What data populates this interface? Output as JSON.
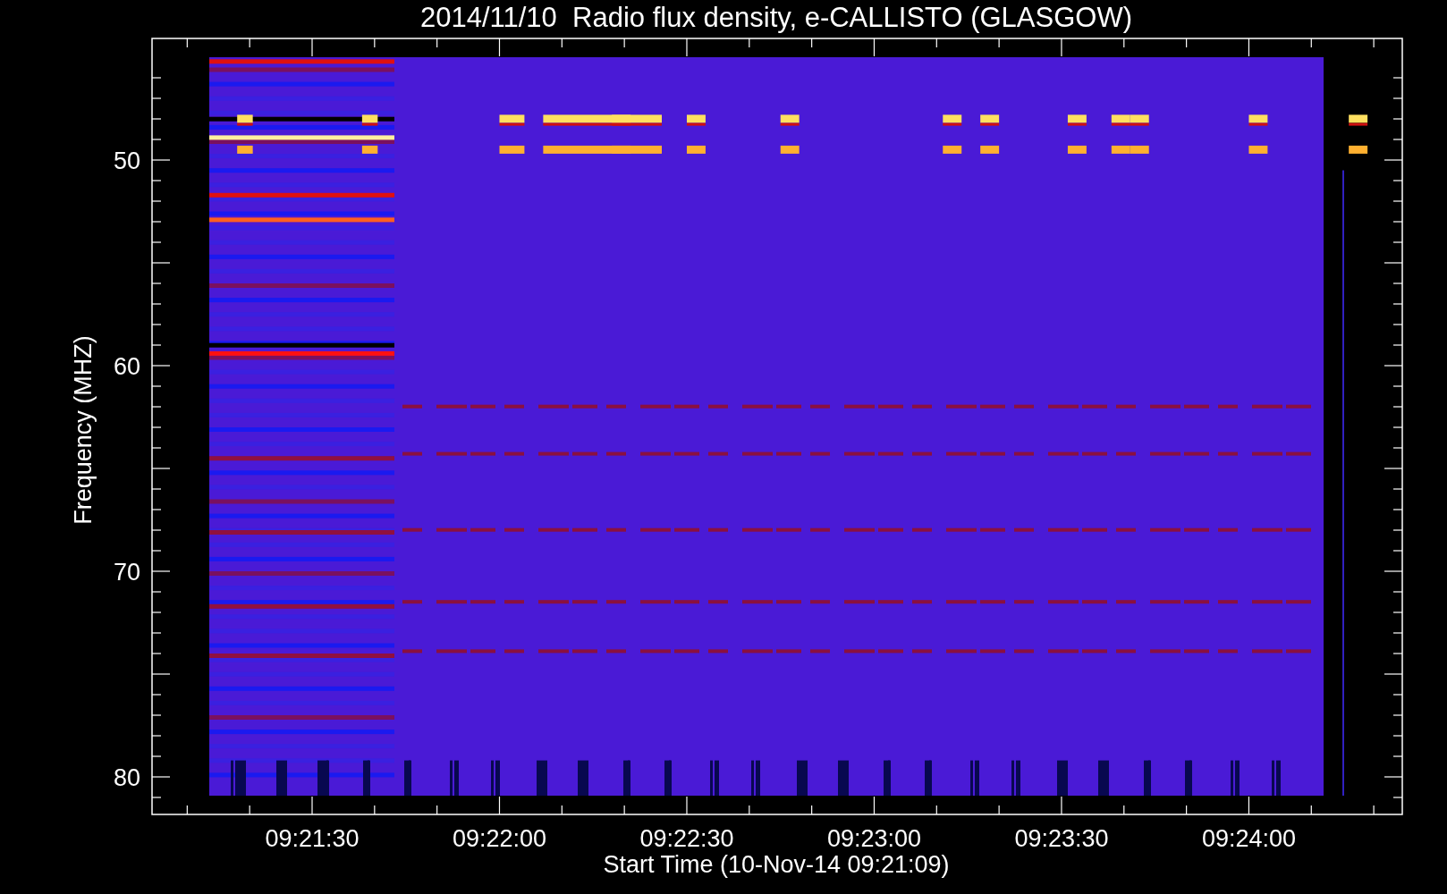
{
  "title": "2014/11/10  Radio flux density, e-CALLISTO (GLASGOW)",
  "ylabel": "Frequency (MHZ)",
  "xlabel": "Start Time (10-Nov-14 09:21:09)",
  "y_tick_labels": [
    "50",
    "60",
    "70",
    "80"
  ],
  "x_tick_labels": [
    "09:21:30",
    "09:22:00",
    "09:22:30",
    "09:23:00",
    "09:23:30",
    "09:24:00"
  ]
}
